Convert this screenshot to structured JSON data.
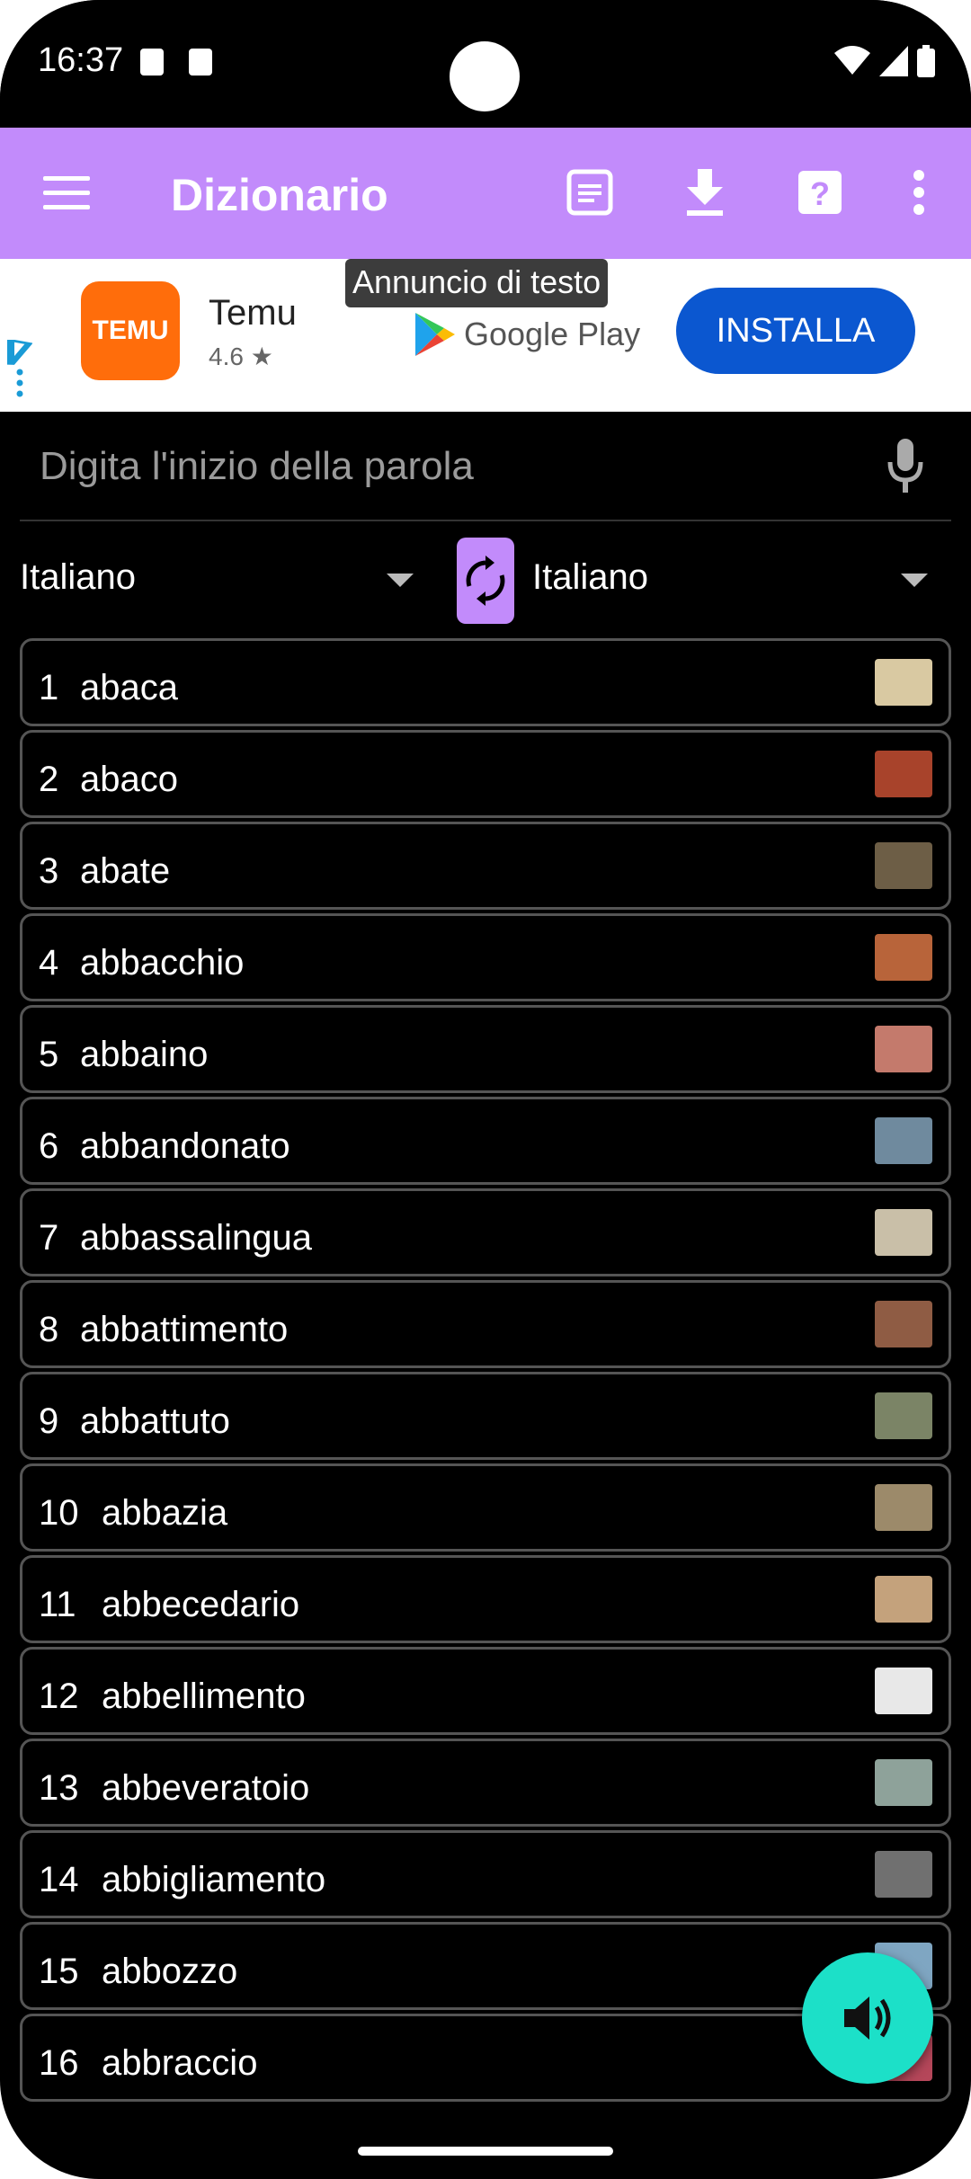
{
  "status_bar": {
    "time": "16:37"
  },
  "app_bar": {
    "title": "Dizionario"
  },
  "ad": {
    "label": "Annuncio di testo",
    "app_name": "Temu",
    "logo_text": "TEMU",
    "rating": "4.6 ★",
    "store": "Google Play",
    "install_label": "INSTALLA"
  },
  "search": {
    "placeholder": "Digita l'inizio della parola"
  },
  "languages": {
    "source": "Italiano",
    "target": "Italiano"
  },
  "colors": {
    "accent": "#c28bfb",
    "fab": "#1ce0c8",
    "install": "#0b57d0"
  },
  "words": [
    {
      "n": "1",
      "w": "abaca",
      "thumb": "#d9c9a2"
    },
    {
      "n": "2",
      "w": "abaco",
      "thumb": "#a8432b"
    },
    {
      "n": "3",
      "w": "abate",
      "thumb": "#6d5e46"
    },
    {
      "n": "4",
      "w": "abbacchio",
      "thumb": "#b8643a"
    },
    {
      "n": "5",
      "w": "abbaino",
      "thumb": "#c47a6c"
    },
    {
      "n": "6",
      "w": "abbandonato",
      "thumb": "#6f8a9e"
    },
    {
      "n": "7",
      "w": "abbassalingua",
      "thumb": "#c9bfa8"
    },
    {
      "n": "8",
      "w": "abbattimento",
      "thumb": "#8f5c44"
    },
    {
      "n": "9",
      "w": "abbattuto",
      "thumb": "#7b8466"
    },
    {
      "n": "10",
      "w": "abbazia",
      "thumb": "#9c8a6a"
    },
    {
      "n": "11",
      "w": "abbecedario",
      "thumb": "#c4a27c"
    },
    {
      "n": "12",
      "w": "abbellimento",
      "thumb": "#e8e8e8"
    },
    {
      "n": "13",
      "w": "abbeveratoio",
      "thumb": "#8ea29a"
    },
    {
      "n": "14",
      "w": "abbigliamento",
      "thumb": "#707070"
    },
    {
      "n": "15",
      "w": "abbozzo",
      "thumb": "#7fa6c2"
    },
    {
      "n": "16",
      "w": "abbraccio",
      "thumb": "#b5475a"
    }
  ]
}
